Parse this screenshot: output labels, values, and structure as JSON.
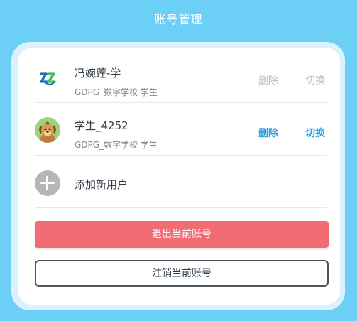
{
  "header": {
    "title": "账号管理"
  },
  "accounts": [
    {
      "name": "冯婉莲-学",
      "school": "GDPG_数字学校 学生",
      "avatar_icon": "school-logo-icon",
      "delete_label": "删除",
      "switch_label": "切换",
      "state": "current-disabled"
    },
    {
      "name": "学生_4252",
      "school": "GDPG_数字学校 学生",
      "avatar_icon": "dog-avatar-icon",
      "delete_label": "删除",
      "switch_label": "切换",
      "state": "enabled"
    }
  ],
  "add_user": {
    "label": "添加新用户",
    "icon": "plus-circle-icon"
  },
  "buttons": {
    "logout_label": "退出当前账号",
    "deregister_label": "注销当前账号"
  },
  "colors": {
    "background": "#6ccff6",
    "action_enabled": "#2e9fd7",
    "action_disabled": "#b8bec4",
    "logout_button": "#f26c74"
  }
}
